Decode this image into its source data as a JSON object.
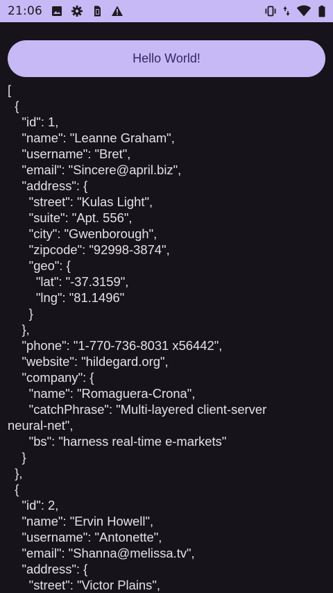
{
  "status_bar": {
    "time": "21:06",
    "left_icons": [
      "image-icon",
      "gear-icon",
      "sim-card-icon",
      "warning-icon"
    ],
    "right_icons": [
      "vibrate-icon",
      "data-arrows-icon",
      "wifi-icon",
      "battery-icon"
    ],
    "background": "#c7b9f6"
  },
  "main": {
    "button_label": "Hello World!",
    "json_text": "[\n  {\n    \"id\": 1,\n    \"name\": \"Leanne Graham\",\n    \"username\": \"Bret\",\n    \"email\": \"Sincere@april.biz\",\n    \"address\": {\n      \"street\": \"Kulas Light\",\n      \"suite\": \"Apt. 556\",\n      \"city\": \"Gwenborough\",\n      \"zipcode\": \"92998-3874\",\n      \"geo\": {\n        \"lat\": \"-37.3159\",\n        \"lng\": \"81.1496\"\n      }\n    },\n    \"phone\": \"1-770-736-8031 x56442\",\n    \"website\": \"hildegard.org\",\n    \"company\": {\n      \"name\": \"Romaguera-Crona\",\n      \"catchPhrase\": \"Multi-layered client-server\nneural-net\",\n      \"bs\": \"harness real-time e-markets\"\n    }\n  },\n  {\n    \"id\": 2,\n    \"name\": \"Ervin Howell\",\n    \"username\": \"Antonette\",\n    \"email\": \"Shanna@melissa.tv\",\n    \"address\": {\n      \"street\": \"Victor Plains\",",
    "background": "#16131a",
    "accent": "#c7b9f6"
  }
}
